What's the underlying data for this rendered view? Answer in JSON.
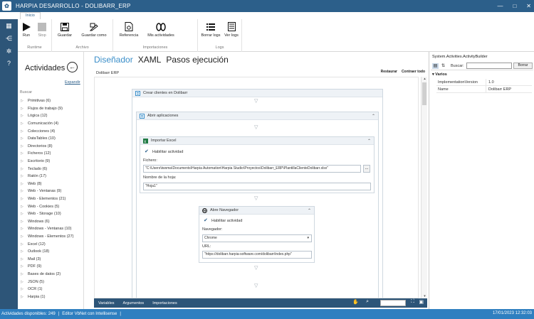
{
  "window": {
    "title": "HARPIA DESARROLLO - DOLIBARR_ERP",
    "controls": [
      "—",
      "□",
      "✕"
    ]
  },
  "menu_tab": "Inicio",
  "ribbon": {
    "groups": [
      {
        "label": "Runtime",
        "buttons": [
          {
            "label": "Run",
            "icon": "play-icon"
          },
          {
            "label": "Stop",
            "icon": "stop-icon"
          }
        ]
      },
      {
        "label": "Archivo",
        "buttons": [
          {
            "label": "Guardar",
            "icon": "save-icon"
          },
          {
            "label": "Guardar como",
            "icon": "save-as-icon"
          }
        ]
      },
      {
        "label": "Importaciones",
        "buttons": [
          {
            "label": "Referencia",
            "icon": "reference-icon"
          },
          {
            "label": "Mis actividades",
            "icon": "activities-icon"
          }
        ]
      },
      {
        "label": "Logs",
        "buttons": [
          {
            "label": "Borrar logs",
            "icon": "clear-logs-icon"
          },
          {
            "label": "Ver logs",
            "icon": "view-logs-icon"
          }
        ]
      }
    ]
  },
  "activities": {
    "title": "Actividades",
    "expand": "Expandir",
    "search": "Buscar",
    "items": [
      "Primitivas (6)",
      "Flujos de trabajo (9)",
      "Lógica (12)",
      "Comunicación (4)",
      "Colecciones (4)",
      "DataTables (10)",
      "Directorios (8)",
      "Ficheros (12)",
      "Escritorio (9)",
      "Teclado (6)",
      "Ratón (17)",
      "Web (8)",
      "Web - Ventanas (9)",
      "Web - Elementos (21)",
      "Web - Cookies (5)",
      "Web - Storage (10)",
      "Windows (6)",
      "Windows - Ventanas (10)",
      "Windows - Elementos (27)",
      "Excel (12)",
      "Outlook (18)",
      "Mail (3)",
      "PDF (9)",
      "Bases de datos (2)",
      "JSON (5)",
      "OCR (1)",
      "Harpia (1)"
    ]
  },
  "designer": {
    "tabs": [
      "Diseñador",
      "XAML",
      "Pasos ejecución"
    ],
    "breadcrumb": "Dolibarr ERP",
    "links": [
      "Restaurar",
      "Contraer todo"
    ],
    "sequence": {
      "title": "Crear clientes en Dolibarr",
      "inner": {
        "title": "Abrir aplicaciones",
        "excel": {
          "title": "Importar Excel",
          "enable": "Habilitar actividad",
          "file_label": "Fichero:",
          "file_value": "\"C:\\Users\\twsma\\Documents\\Harpia Automation\\Harpia Studio\\Proyectos\\Dolibarr_ERP\\PlantillaClienteDolibarr.xlsx\"",
          "sheet_label": "Nombre de la hoja:",
          "sheet_value": "\"Hoja1\"",
          "browse": "..."
        },
        "browser": {
          "title": "Abre Navegador",
          "enable": "Habilitar actividad",
          "nav_label": "Navegador:",
          "nav_value": "Chrome",
          "url_label": "URL:",
          "url_value": "\"https://dolibarr.harpia-software.com/dolibarr/index.php\""
        }
      }
    },
    "bottom_tabs": [
      "Variables",
      "Argumentos",
      "Importaciones"
    ]
  },
  "properties": {
    "header": "System.Activities.ActivityBuilder",
    "search_label": "Buscar:",
    "clear_button": "Borrar",
    "category": "Varios",
    "rows": [
      {
        "key": "ImplementationVersion",
        "value": "1.0"
      },
      {
        "key": "Name",
        "value": "Dolibarr ERP"
      }
    ]
  },
  "status": {
    "activities": "Actividades disponibles: 249",
    "editor": "Editor VbNet con Intellisense",
    "datetime": "17/01/2023 12:32:03"
  },
  "colors": {
    "titlebar": "#2c5f8a",
    "sidebar": "#2d5578",
    "status": "#2f7fc0",
    "accent": "#3a8ec9"
  }
}
